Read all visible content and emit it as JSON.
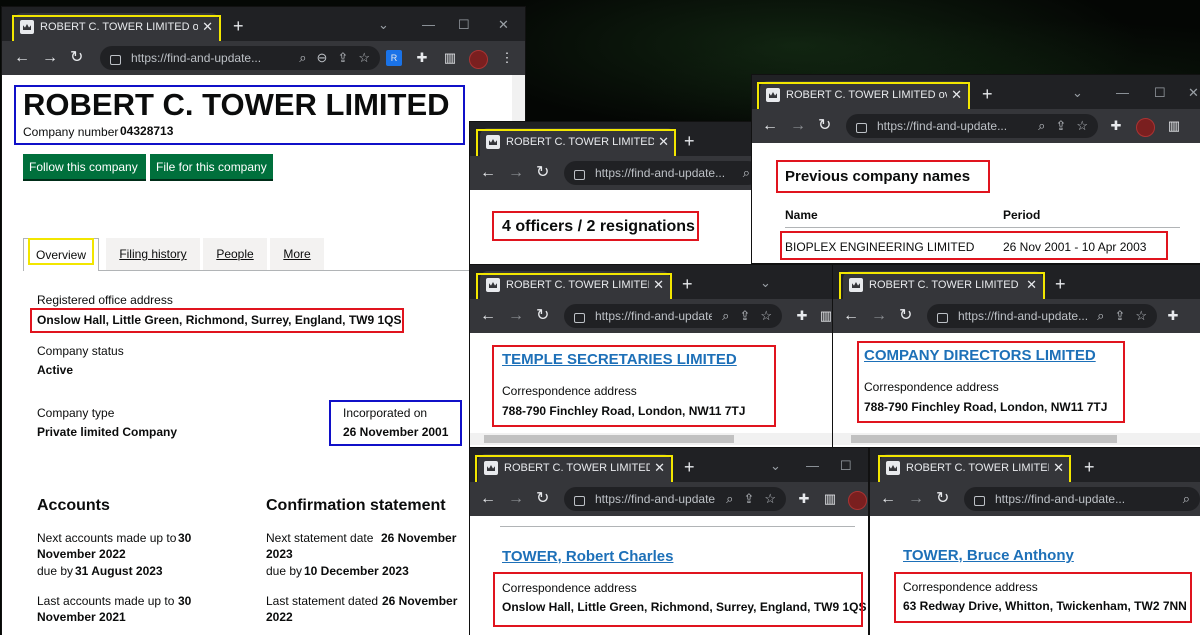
{
  "tab_title": "ROBERT C. TOWER LIMITED overview",
  "tab_title_people": "ROBERT C. TOWER LIMITED people",
  "url": "https://find-and-update...",
  "main": {
    "company_name": "ROBERT C. TOWER LIMITED",
    "company_number_label": "Company number",
    "company_number": "04328713",
    "follow_button": "Follow this company",
    "file_button": "File for this company",
    "tabs": [
      "Overview",
      "Filing history",
      "People",
      "More"
    ],
    "registered_office_label": "Registered office address",
    "registered_office": "Onslow Hall, Little Green, Richmond, Surrey, England, TW9 1QS",
    "status_label": "Company status",
    "status": "Active",
    "type_label": "Company type",
    "type": "Private limited Company",
    "incorporated_label": "Incorporated on",
    "incorporated": "26 November 2001",
    "accounts": {
      "heading": "Accounts",
      "next_label": "Next accounts made up to",
      "next_date_a": "30",
      "next_date_b": "November 2022",
      "due_label": "due by",
      "due_date": "31 August 2023",
      "last_label": "Last accounts made up to",
      "last_date_a": "30",
      "last_date_b": "November 2021"
    },
    "confirmation": {
      "heading": "Confirmation statement",
      "next_label": "Next statement date",
      "next_date_a": "26 November",
      "next_date_b": "2023",
      "due_label": "due by",
      "due_date": "10 December 2023",
      "last_label": "Last statement dated",
      "last_date_a": "26 November",
      "last_date_b": "2022"
    }
  },
  "previous_names": {
    "heading": "Previous company names",
    "col_name": "Name",
    "col_period": "Period",
    "name": "BIOPLEX ENGINEERING LIMITED",
    "period": "26 Nov 2001 - 10 Apr 2003"
  },
  "officers_summary": "4 officers / 2 resignations",
  "correspondence_label": "Correspondence address",
  "officers": [
    {
      "name": "TEMPLE SECRETARIES LIMITED",
      "address": "788-790 Finchley Road, London, NW11 7TJ"
    },
    {
      "name": "COMPANY DIRECTORS LIMITED",
      "address": "788-790 Finchley Road, London, NW11 7TJ"
    },
    {
      "name": "TOWER, Robert Charles",
      "address": "Onslow Hall, Little Green, Richmond, Surrey, England, TW9 1QS"
    },
    {
      "name": "TOWER, Bruce Anthony",
      "address": "63 Redway Drive, Whitton, Twickenham, TW2 7NN"
    }
  ],
  "icons": [
    "crown-icon",
    "close-icon",
    "plus-icon",
    "back-icon",
    "forward-icon",
    "reload-icon",
    "lock-icon",
    "search-icon",
    "zoom-icon",
    "share-icon",
    "star-icon",
    "extensions-icon",
    "sidebar-icon",
    "avatar"
  ],
  "colors": {
    "highlight_yellow": "#f2e600",
    "highlight_red": "#e0141e",
    "highlight_blue": "#1010c8",
    "gov_green": "#00703c",
    "gov_link": "#1d70b8"
  }
}
